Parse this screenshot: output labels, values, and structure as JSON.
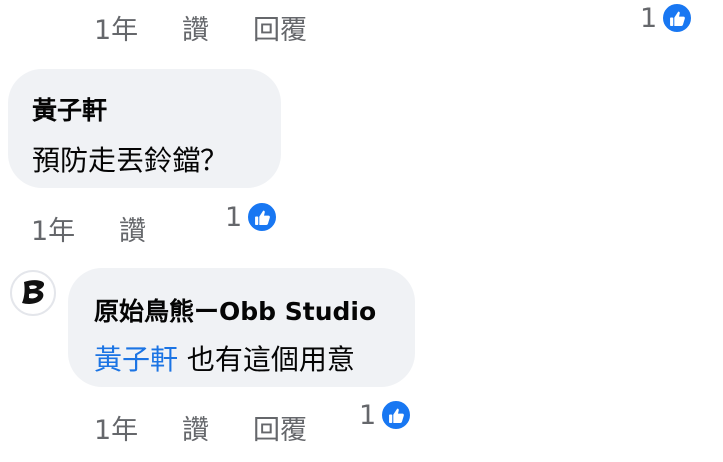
{
  "colors": {
    "link": "#1b74e4",
    "meta": "#65676b",
    "bubble": "#f0f2f5",
    "like": "#1877f2"
  },
  "comment_top": {
    "time": "1年",
    "like_label": "讚",
    "reply_label": "回覆",
    "reaction_count": "1",
    "reaction_icon": "thumbs-up-icon"
  },
  "comment_1": {
    "author": "黃子軒",
    "text": "預防走丟鈴鐺？",
    "time": "1年",
    "like_label": "讚",
    "reaction_count": "1",
    "reaction_icon": "thumbs-up-icon"
  },
  "comment_2": {
    "avatar_icon": "obb-studio-logo",
    "author": "原始鳥熊ーObb Studio",
    "mention": "黃子軒",
    "text": "也有這個用意",
    "time": "1年",
    "like_label": "讚",
    "reply_label": "回覆",
    "reaction_count": "1",
    "reaction_icon": "thumbs-up-icon"
  }
}
